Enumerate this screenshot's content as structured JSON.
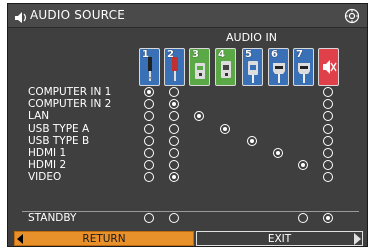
{
  "window": {
    "title": "AUDIO SOURCE",
    "icon": "speaker-icon",
    "corner_button_icon": "settings-dial-icon"
  },
  "header": {
    "label": "AUDIO IN"
  },
  "audio_inputs": [
    {
      "number": "1",
      "icon": "mini-jack-icon",
      "color": "#3a70b5"
    },
    {
      "number": "2",
      "icon": "rca-plug-icon",
      "color": "#3a70b5"
    },
    {
      "number": "3",
      "icon": "usb-a-icon",
      "color": "#5aa846"
    },
    {
      "number": "4",
      "icon": "usb-b-icon",
      "color": "#5aa846"
    },
    {
      "number": "5",
      "icon": "lan-icon",
      "color": "#3a70b5"
    },
    {
      "number": "6",
      "icon": "hdmi-icon",
      "color": "#3a70b5"
    },
    {
      "number": "7",
      "icon": "hdmi-icon",
      "color": "#3a70b5"
    },
    {
      "number": "",
      "icon": "mute-speaker-icon",
      "color": "#e0404a"
    }
  ],
  "rows": [
    {
      "label": "COMPUTER IN 1",
      "options": [
        1,
        1,
        0,
        0,
        0,
        0,
        0,
        1
      ],
      "selected": 0
    },
    {
      "label": "COMPUTER IN 2",
      "options": [
        1,
        1,
        0,
        0,
        0,
        0,
        0,
        1
      ],
      "selected": 1
    },
    {
      "label": "LAN",
      "options": [
        1,
        1,
        1,
        0,
        0,
        0,
        0,
        1
      ],
      "selected": 2
    },
    {
      "label": "USB TYPE A",
      "options": [
        1,
        1,
        0,
        1,
        0,
        0,
        0,
        1
      ],
      "selected": 3
    },
    {
      "label": "USB TYPE B",
      "options": [
        1,
        1,
        0,
        0,
        1,
        0,
        0,
        1
      ],
      "selected": 4
    },
    {
      "label": "HDMI 1",
      "options": [
        1,
        1,
        0,
        0,
        0,
        1,
        0,
        1
      ],
      "selected": 5
    },
    {
      "label": "HDMI 2",
      "options": [
        1,
        1,
        0,
        0,
        0,
        0,
        1,
        1
      ],
      "selected": 6
    },
    {
      "label": "VIDEO",
      "options": [
        1,
        1,
        0,
        0,
        0,
        0,
        0,
        1
      ],
      "selected": 1
    }
  ],
  "standby": {
    "label": "STANDBY",
    "options": [
      1,
      1,
      0,
      0,
      0,
      0,
      1,
      1
    ],
    "selected": 7
  },
  "buttons": {
    "return_label": "RETURN",
    "exit_label": "EXIT"
  }
}
